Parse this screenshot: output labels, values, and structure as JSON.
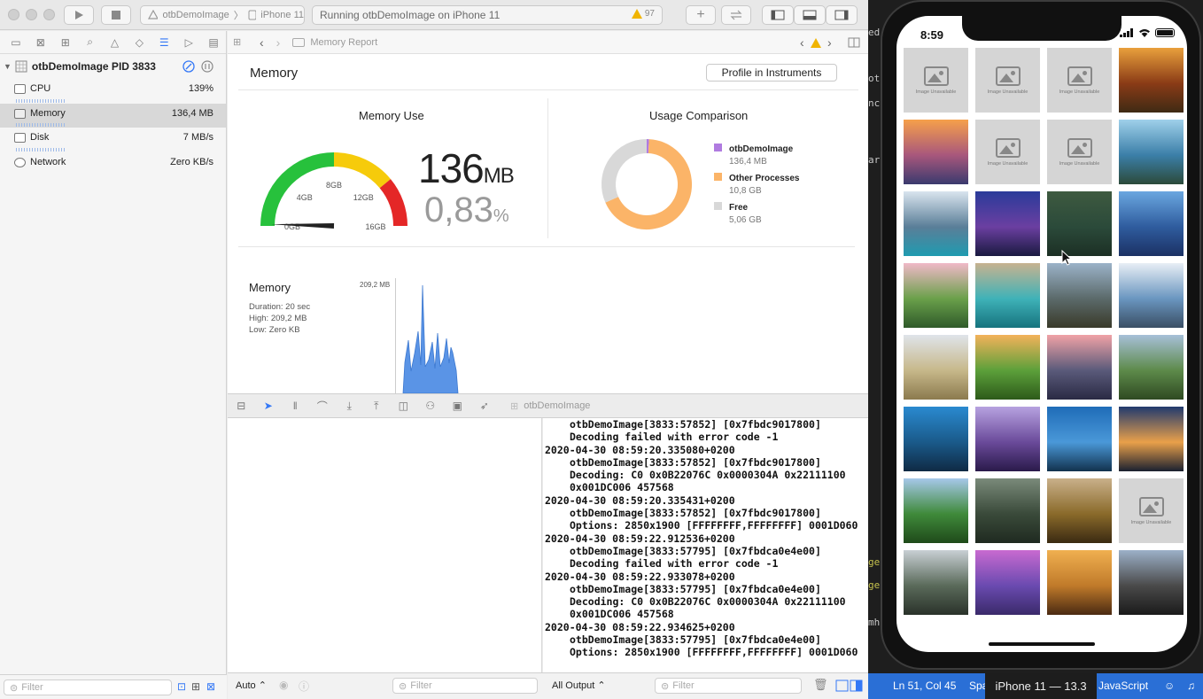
{
  "toolbar": {
    "scheme": "otbDemoImage",
    "destination": "iPhone 11",
    "status": "Running otbDemoImage on iPhone 11",
    "warning_count": "97"
  },
  "navigator": {
    "process": "otbDemoImage PID 3833",
    "gauges": [
      {
        "label": "CPU",
        "value": "139%"
      },
      {
        "label": "Memory",
        "value": "136,4 MB"
      },
      {
        "label": "Disk",
        "value": "7 MB/s"
      },
      {
        "label": "Network",
        "value": "Zero KB/s"
      }
    ],
    "filter_placeholder": "Filter"
  },
  "editor": {
    "breadcrumb": "Memory Report",
    "title": "Memory",
    "profile_button": "Profile in Instruments",
    "memory_use": {
      "title": "Memory Use",
      "value": "136",
      "unit": "MB",
      "percent": "0,83",
      "percent_unit": "%",
      "gauge_labels": [
        "0GB",
        "4GB",
        "8GB",
        "12GB",
        "16GB"
      ],
      "gauge_fraction": 0.0083,
      "colors": {
        "green": "#27c13c",
        "yellow": "#f6cb0b",
        "red": "#e42727"
      }
    },
    "usage": {
      "title": "Usage Comparison",
      "items": [
        {
          "name": "otbDemoImage",
          "value": "136,4 MB",
          "color": "#b07be0",
          "amount_gb": 0.1364
        },
        {
          "name": "Other Processes",
          "value": "10,8 GB",
          "color": "#fbb468",
          "amount_gb": 10.8
        },
        {
          "name": "Free",
          "value": "5,06 GB",
          "color": "#d8d8d8",
          "amount_gb": 5.06
        }
      ]
    },
    "timeline": {
      "title": "Memory",
      "duration": "Duration: 20 sec",
      "high": "High: 209,2 MB",
      "low": "Low: Zero KB",
      "max_label": "209,2 MB"
    }
  },
  "debug": {
    "process": "otbDemoImage",
    "auto_label": "Auto",
    "output_label": "All Output",
    "filter_placeholder": "Filter",
    "console_lines": [
      {
        "text": "otbDemoImage[3833:57852] [0x7fbdc9017800]",
        "indent": true
      },
      {
        "text": "Decoding failed with error code -1",
        "indent": true
      },
      {
        "text": "2020-04-30 08:59:20.335080+0200",
        "indent": false
      },
      {
        "text": "otbDemoImage[3833:57852] [0x7fbdc9017800]",
        "indent": true
      },
      {
        "text": "Decoding: C0 0x0B22076C 0x0000304A 0x22111100",
        "indent": true
      },
      {
        "text": "0x001DC006 457568",
        "indent": true
      },
      {
        "text": "2020-04-30 08:59:20.335431+0200",
        "indent": false
      },
      {
        "text": "otbDemoImage[3833:57852] [0x7fbdc9017800]",
        "indent": true
      },
      {
        "text": "Options: 2850x1900 [FFFFFFFF,FFFFFFFF] 0001D060",
        "indent": true
      },
      {
        "text": "2020-04-30 08:59:22.912536+0200",
        "indent": false
      },
      {
        "text": "otbDemoImage[3833:57795] [0x7fbdca0e4e00]",
        "indent": true
      },
      {
        "text": "Decoding failed with error code -1",
        "indent": true
      },
      {
        "text": "2020-04-30 08:59:22.933078+0200",
        "indent": false
      },
      {
        "text": "otbDemoImage[3833:57795] [0x7fbdca0e4e00]",
        "indent": true
      },
      {
        "text": "Decoding: C0 0x0B22076C 0x0000304A 0x22111100",
        "indent": true
      },
      {
        "text": "0x001DC006 457568",
        "indent": true
      },
      {
        "text": "2020-04-30 08:59:22.934625+0200",
        "indent": false
      },
      {
        "text": "otbDemoImage[3833:57795] [0x7fbdca0e4e00]",
        "indent": true
      },
      {
        "text": "Options: 2850x1900 [FFFFFFFF,FFFFFFFF] 0001D060",
        "indent": true
      }
    ]
  },
  "background_fragments": [
    "ed-",
    "ot",
    "nc",
    "ar",
    "ge",
    "ge",
    "mh"
  ],
  "statusbar": {
    "position": "Ln 51, Col 45",
    "spaces": "Spa",
    "device": "iPhone 11 — 13.3",
    "language": "JavaScript"
  },
  "simulator": {
    "time": "8:59",
    "unavailable_caption": "Image Unavailable",
    "tiles": [
      {
        "unavailable": true
      },
      {
        "unavailable": true
      },
      {
        "unavailable": true
      },
      {
        "colors": [
          "#e9a03c",
          "#8a3b16",
          "#3f2a14"
        ]
      },
      {
        "colors": [
          "#f6a04a",
          "#a8577c",
          "#3a3a6e"
        ]
      },
      {
        "unavailable": true
      },
      {
        "unavailable": true
      },
      {
        "colors": [
          "#9fd0ea",
          "#3b7fa8",
          "#2c4a3a"
        ]
      },
      {
        "colors": [
          "#d9e4ee",
          "#5a7e98",
          "#1f9bb0"
        ]
      },
      {
        "colors": [
          "#2a3b9a",
          "#6b3fa1",
          "#1a1a40"
        ]
      },
      {
        "colors": [
          "#3e5a40",
          "#2b4a3a",
          "#1c2f24"
        ]
      },
      {
        "colors": [
          "#6aa7e0",
          "#2f5c9e",
          "#1b3164"
        ]
      },
      {
        "colors": [
          "#f0b9c8",
          "#6aa04a",
          "#2f5a2a"
        ]
      },
      {
        "colors": [
          "#c7b28f",
          "#3fb2b8",
          "#16737e"
        ]
      },
      {
        "colors": [
          "#9bb2c8",
          "#5b6a6a",
          "#3a3a2a"
        ]
      },
      {
        "colors": [
          "#e8eef5",
          "#6a96c0",
          "#3a4e64"
        ]
      },
      {
        "colors": [
          "#dfe4ea",
          "#c7b88a",
          "#8b7a4e"
        ]
      },
      {
        "colors": [
          "#f3b25a",
          "#5ca03a",
          "#2d5a1a"
        ]
      },
      {
        "colors": [
          "#f0a2a6",
          "#5a5a7a",
          "#2a2a44"
        ]
      },
      {
        "colors": [
          "#a7c0d8",
          "#5d8a4a",
          "#2f4a22"
        ]
      },
      {
        "colors": [
          "#2a8ad0",
          "#1a5a8a",
          "#0f2a44"
        ]
      },
      {
        "colors": [
          "#b7a2e0",
          "#6a4a9a",
          "#2a1a4a"
        ]
      },
      {
        "colors": [
          "#1f6cb8",
          "#4a98d8",
          "#12324e"
        ]
      },
      {
        "colors": [
          "#203a6e",
          "#e9a04a",
          "#1a2030"
        ]
      },
      {
        "colors": [
          "#a6c8ea",
          "#3f8a3a",
          "#1f4a1a"
        ]
      },
      {
        "colors": [
          "#7a8a7a",
          "#3a4a3a",
          "#1f2a20"
        ]
      },
      {
        "colors": [
          "#c9b08a",
          "#8a6a2a",
          "#3a2a12"
        ]
      },
      {
        "unavailable": true
      },
      {
        "colors": [
          "#c8cfd4",
          "#5a6a5a",
          "#2a322a"
        ]
      },
      {
        "colors": [
          "#c86ad0",
          "#6a4ab0",
          "#3a2a6a"
        ]
      },
      {
        "colors": [
          "#f0b050",
          "#c07a2a",
          "#4a2a12"
        ]
      },
      {
        "colors": [
          "#9cb0c8",
          "#4a4a4a",
          "#1a1a1a"
        ]
      }
    ]
  }
}
